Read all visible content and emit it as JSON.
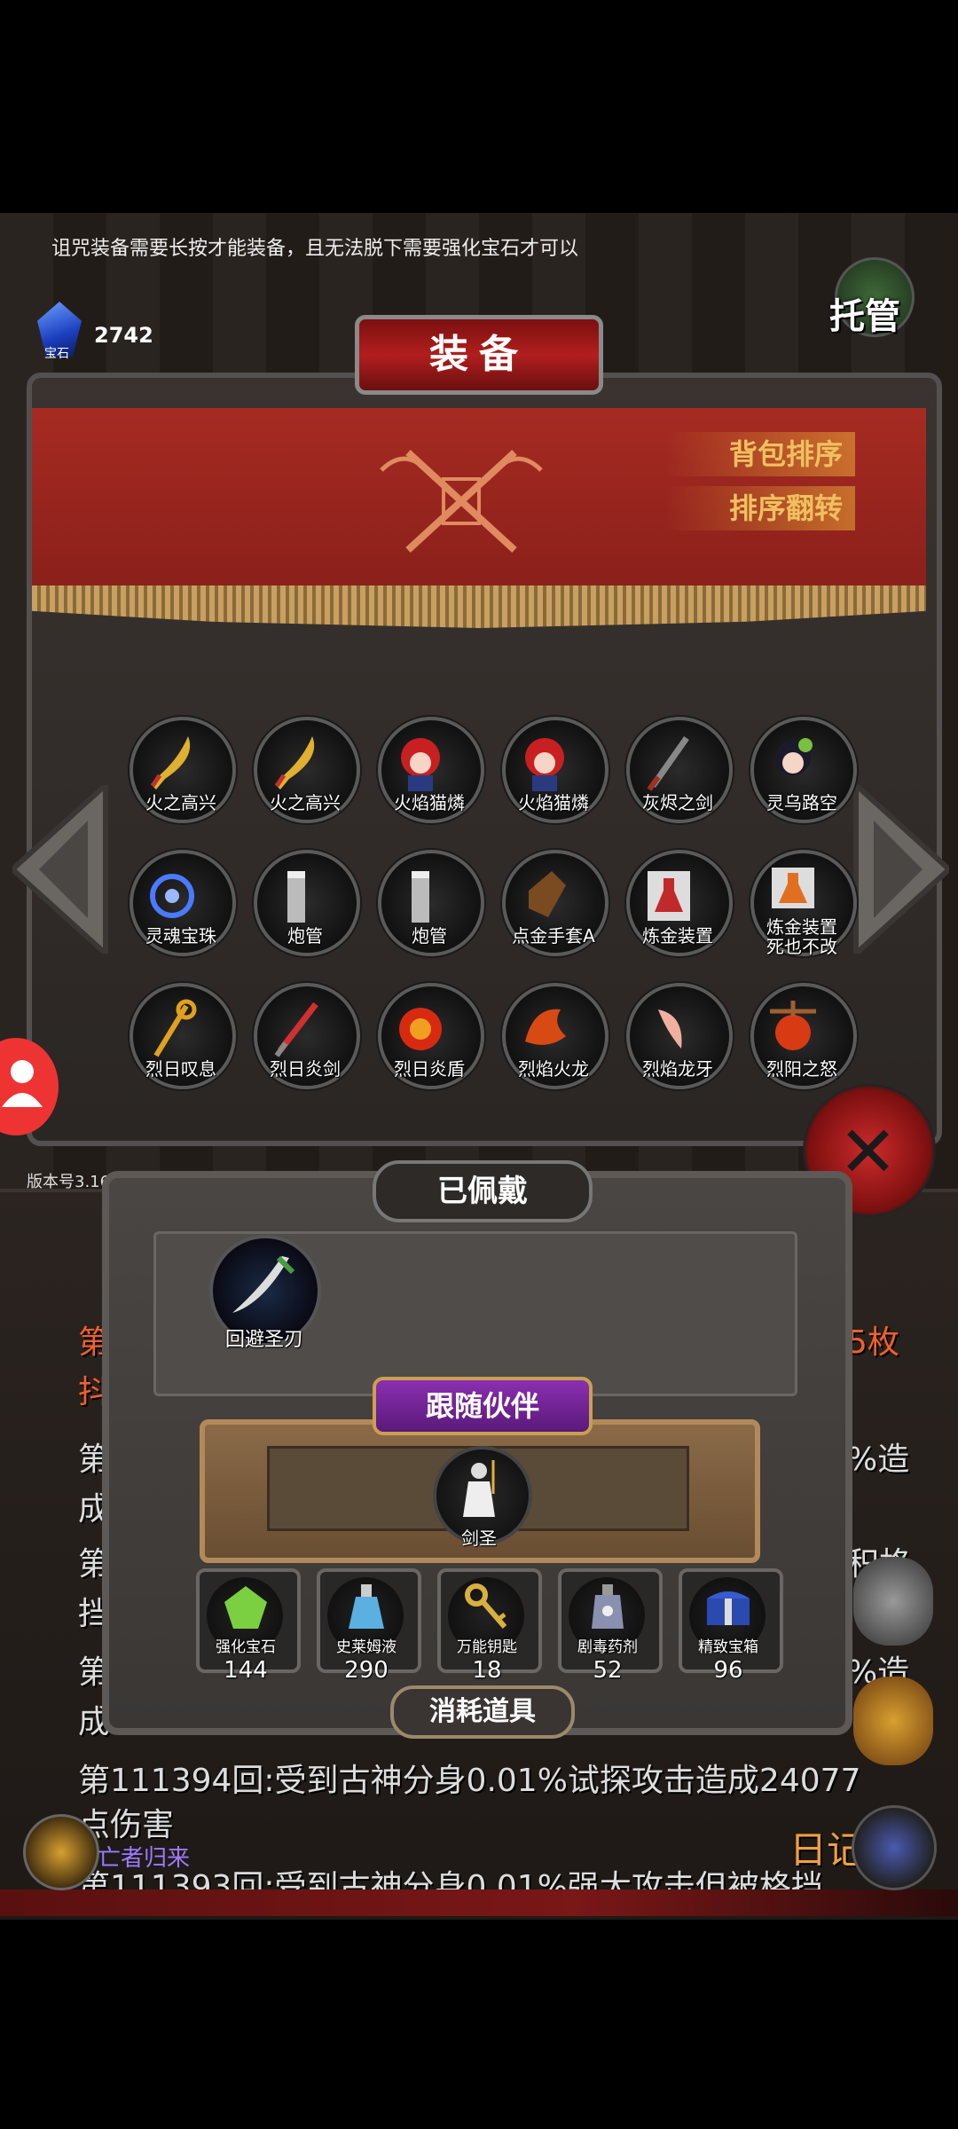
{
  "hint": "诅咒装备需要长按才能装备，且无法脱下需要强化宝石才可以",
  "currency": {
    "label": "宝石",
    "value": "2742"
  },
  "auto_button": "托管",
  "panel": {
    "title": "装备",
    "sort_bag": "背包排序",
    "sort_flip": "排序翻转"
  },
  "items": [
    {
      "label": "火之高兴"
    },
    {
      "label": "火之高兴"
    },
    {
      "label": "火焰猫燐"
    },
    {
      "label": "火焰猫燐"
    },
    {
      "label": "灰烬之剑"
    },
    {
      "label": "灵乌路空"
    },
    {
      "label": "灵魂宝珠"
    },
    {
      "label": "炮管"
    },
    {
      "label": "炮管"
    },
    {
      "label": "点金手套A"
    },
    {
      "label": "炼金装置"
    },
    {
      "label": "炼金装置\n死也不改"
    },
    {
      "label": "烈日叹息"
    },
    {
      "label": "烈日炎剑"
    },
    {
      "label": "烈日炎盾"
    },
    {
      "label": "烈焰火龙"
    },
    {
      "label": "烈焰龙牙"
    },
    {
      "label": "烈阳之怒"
    }
  ],
  "version": "版本号3.16",
  "equipped": {
    "title": "已佩戴",
    "item": "回避圣刃"
  },
  "companion": {
    "title": "跟随伙伴",
    "name": "剑圣"
  },
  "consumables": {
    "title": "消耗道具",
    "list": [
      {
        "label": "强化宝石",
        "count": "144"
      },
      {
        "label": "史莱姆液",
        "count": "290"
      },
      {
        "label": "万能钥匙",
        "count": "18"
      },
      {
        "label": "剧毒药剂",
        "count": "52"
      },
      {
        "label": "精致宝箱",
        "count": "96"
      }
    ]
  },
  "log": {
    "l1_left": "第",
    "l1_right": "5枚",
    "l1b_left": "抖",
    "l2_left": "第",
    "l2_right": "%造",
    "l2b_left": "成",
    "l3_left": "第",
    "l3_right": "积格",
    "l3b_left": "挡",
    "l4_left": "第",
    "l4_right": "%造",
    "l4b_left": "成",
    "l5": "第111394回:受到古神分身0.01%试探攻击造成24077",
    "l5b": "点伤害",
    "l6": "第111393回:受到古神分身0.01%强大攻击但被格挡"
  },
  "diary": "日记",
  "dead_return": "亡者归来"
}
